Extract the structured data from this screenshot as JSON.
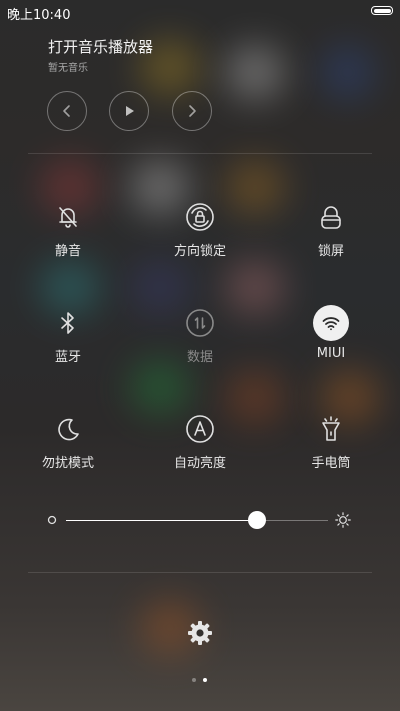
{
  "status_bar": {
    "time": "晚上10:40"
  },
  "music": {
    "title": "打开音乐播放器",
    "subtitle": "暂无音乐",
    "controls": [
      "previous-icon",
      "play-icon",
      "next-icon"
    ]
  },
  "toggles": [
    {
      "label": "静音",
      "icon": "bell-off-icon",
      "active": false
    },
    {
      "label": "方向锁定",
      "icon": "rotation-lock-icon",
      "active": false
    },
    {
      "label": "锁屏",
      "icon": "lock-icon",
      "active": false
    },
    {
      "label": "蓝牙",
      "icon": "bluetooth-icon",
      "active": false
    },
    {
      "label": "数据",
      "icon": "mobile-data-icon",
      "active": false,
      "disabled": true
    },
    {
      "label": "MIUI",
      "icon": "wifi-icon",
      "active": true
    },
    {
      "label": "勿扰模式",
      "icon": "moon-icon",
      "active": false
    },
    {
      "label": "自动亮度",
      "icon": "auto-brightness-icon",
      "active": false
    },
    {
      "label": "手电筒",
      "icon": "flashlight-icon",
      "active": false
    }
  ],
  "brightness": {
    "level": 0.73
  },
  "pager": {
    "pages": 2,
    "current": 2
  },
  "colors": {
    "active_toggle_bg": "#f0f0f0",
    "label": "#e6e6e6",
    "disabled_label": "#8a8a8a"
  }
}
